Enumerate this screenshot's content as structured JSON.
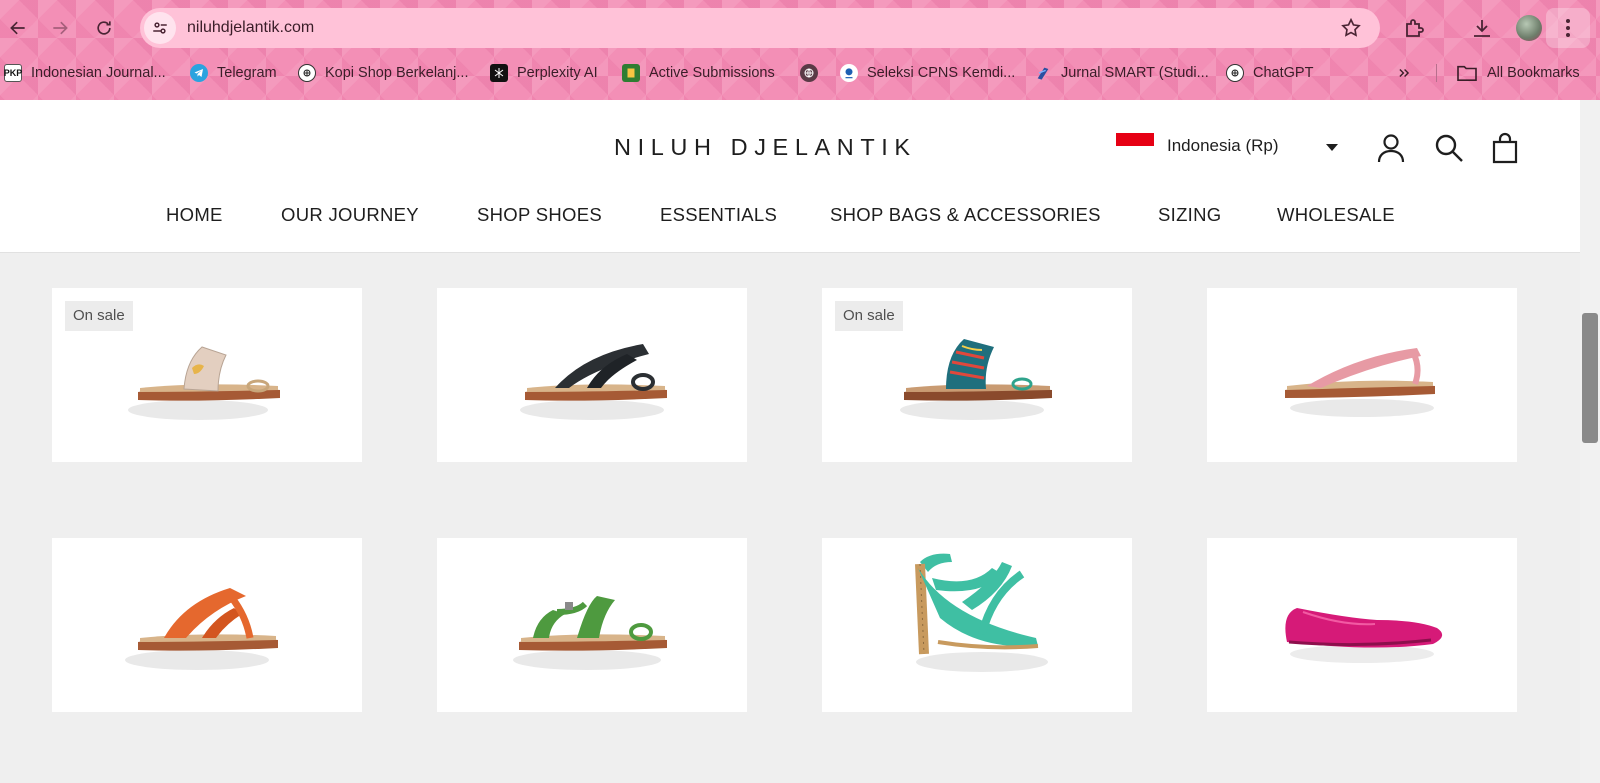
{
  "browser": {
    "url": "niluhdjelantik.com",
    "bookmarks": [
      {
        "label": "Indonesian Journal...",
        "icon": "pkp-icon",
        "icon_text": "PKP"
      },
      {
        "label": "Telegram",
        "icon": "telegram-icon"
      },
      {
        "label": "Kopi Shop Berkelanj...",
        "icon": "openai-icon"
      },
      {
        "label": "Perplexity AI",
        "icon": "perplexity-icon"
      },
      {
        "label": "Active Submissions",
        "icon": "journal-icon"
      },
      {
        "label": "",
        "icon": "globe-icon"
      },
      {
        "label": "Seleksi CPNS Kemdi...",
        "icon": "cpns-icon"
      },
      {
        "label": "Jurnal SMART (Studi...",
        "icon": "smart-journal-icon"
      },
      {
        "label": "ChatGPT",
        "icon": "openai-icon"
      }
    ],
    "all_bookmarks_label": "All Bookmarks"
  },
  "header": {
    "logo": "NILUH DJELANTIK",
    "country_label": "Indonesia (Rp)",
    "flag_colors": [
      "#e60014",
      "#ffffff"
    ]
  },
  "nav": {
    "items": [
      "HOME",
      "OUR JOURNEY",
      "SHOP SHOES",
      "ESSENTIALS",
      "SHOP BAGS & ACCESSORIES",
      "SIZING",
      "WHOLESALE"
    ]
  },
  "products": [
    {
      "badge": "On sale",
      "style": "toe-ring flat sandal",
      "color": "#e3cfc0"
    },
    {
      "badge": "",
      "style": "cross-strap flat sandal",
      "color": "#2b2f33"
    },
    {
      "badge": "On sale",
      "style": "toe-ring flat sandal",
      "color": "#1f6f7d"
    },
    {
      "badge": "",
      "style": "thong flat sandal",
      "color": "#e79aa4"
    },
    {
      "badge": "",
      "style": "t-strap flat sandal",
      "color": "#e5682e"
    },
    {
      "badge": "",
      "style": "slingback flat sandal",
      "color": "#4e9a3f"
    },
    {
      "badge": "",
      "style": "strappy high heel",
      "color": "#3fbfa3"
    },
    {
      "badge": "",
      "style": "ballet flat",
      "color": "#d61a78"
    }
  ]
}
